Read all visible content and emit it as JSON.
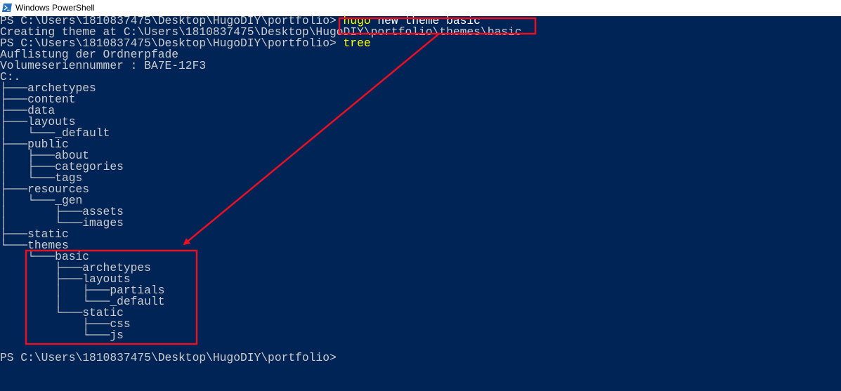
{
  "window": {
    "title": "Windows PowerShell",
    "icon": "powershell-icon"
  },
  "console": {
    "prompt1": "PS C:\\Users\\1810837475\\Desktop\\HugoDIY\\portfolio> ",
    "command1": {
      "cmd": "hugo",
      "args": " new theme basic"
    },
    "creating": "Creating theme at C:\\Users\\1810837475\\Desktop\\HugoDIY\\portfolio\\themes\\basic",
    "prompt2": "PS C:\\Users\\1810837475\\Desktop\\HugoDIY\\portfolio> ",
    "command2": {
      "cmd": "tree"
    },
    "listing_header": "Auflistung der Ordnerpfade",
    "volume": "Volumeseriennummer : BA7E-12F3",
    "root": "C:.",
    "tree": [
      {
        "prefix": "├───",
        "name": "archetypes"
      },
      {
        "prefix": "├───",
        "name": "content"
      },
      {
        "prefix": "├───",
        "name": "data"
      },
      {
        "prefix": "├───",
        "name": "layouts"
      },
      {
        "prefix": "│   └───",
        "name": "_default"
      },
      {
        "prefix": "├───",
        "name": "public"
      },
      {
        "prefix": "│   ├───",
        "name": "about"
      },
      {
        "prefix": "│   ├───",
        "name": "categories"
      },
      {
        "prefix": "│   └───",
        "name": "tags"
      },
      {
        "prefix": "├───",
        "name": "resources"
      },
      {
        "prefix": "│   └───",
        "name": "_gen"
      },
      {
        "prefix": "│       ├───",
        "name": "assets"
      },
      {
        "prefix": "│       └───",
        "name": "images"
      },
      {
        "prefix": "├───",
        "name": "static"
      },
      {
        "prefix": "└───",
        "name": "themes"
      },
      {
        "prefix": "    └───",
        "name": "basic"
      },
      {
        "prefix": "        ├───",
        "name": "archetypes"
      },
      {
        "prefix": "        ├───",
        "name": "layouts"
      },
      {
        "prefix": "        │   ├───",
        "name": "partials"
      },
      {
        "prefix": "        │   └───",
        "name": "_default"
      },
      {
        "prefix": "        └───",
        "name": "static"
      },
      {
        "prefix": "            ├───",
        "name": "css"
      },
      {
        "prefix": "            └───",
        "name": "js"
      }
    ],
    "final_prompt": "PS C:\\Users\\1810837475\\Desktop\\HugoDIY\\portfolio>"
  },
  "annotations": {
    "color": "#e81123"
  },
  "colors": {
    "background": "#012456",
    "text": "#cccccc",
    "command": "#ffff00",
    "argument": "#ffffff"
  }
}
